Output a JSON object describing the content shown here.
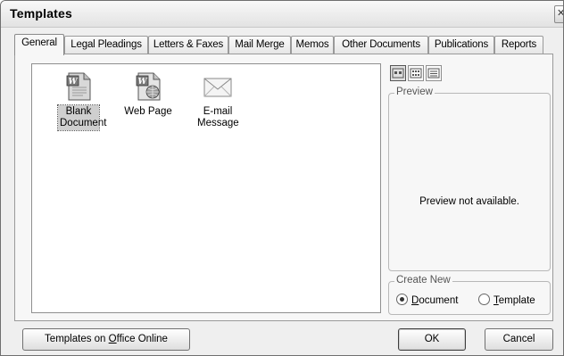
{
  "window": {
    "title": "Templates",
    "close_glyph": "✕"
  },
  "tabs": [
    {
      "label": "General",
      "active": true
    },
    {
      "label": "Legal Pleadings"
    },
    {
      "label": "Letters & Faxes"
    },
    {
      "label": "Mail Merge"
    },
    {
      "label": "Memos"
    },
    {
      "label": "Other Documents"
    },
    {
      "label": "Publications"
    },
    {
      "label": "Reports"
    }
  ],
  "templates": [
    {
      "label": "Blank Document",
      "icon": "word-document-icon",
      "selected": true
    },
    {
      "label": "Web Page",
      "icon": "web-page-icon",
      "selected": false
    },
    {
      "label": "E-mail Message",
      "icon": "email-envelope-icon",
      "selected": false
    }
  ],
  "view_buttons": [
    {
      "icon": "large-icons-view-icon",
      "pressed": true
    },
    {
      "icon": "list-view-icon",
      "pressed": false
    },
    {
      "icon": "details-view-icon",
      "pressed": false
    }
  ],
  "preview": {
    "group_label": "Preview",
    "message": "Preview not available."
  },
  "create_new": {
    "group_label": "Create New",
    "options": [
      {
        "label_pre": "",
        "label_accel": "D",
        "label_post": "ocument",
        "checked": true
      },
      {
        "label_pre": "",
        "label_accel": "T",
        "label_post": "emplate",
        "checked": false
      }
    ]
  },
  "buttons": {
    "office_online": {
      "label_pre": "Templates on ",
      "label_accel": "O",
      "label_post": "ffice Online"
    },
    "ok": "OK",
    "cancel": "Cancel"
  },
  "colors": {
    "dialog_bg": "#efefef",
    "panel_bg": "#f7f7f7",
    "selection": "#cfcfcf"
  }
}
